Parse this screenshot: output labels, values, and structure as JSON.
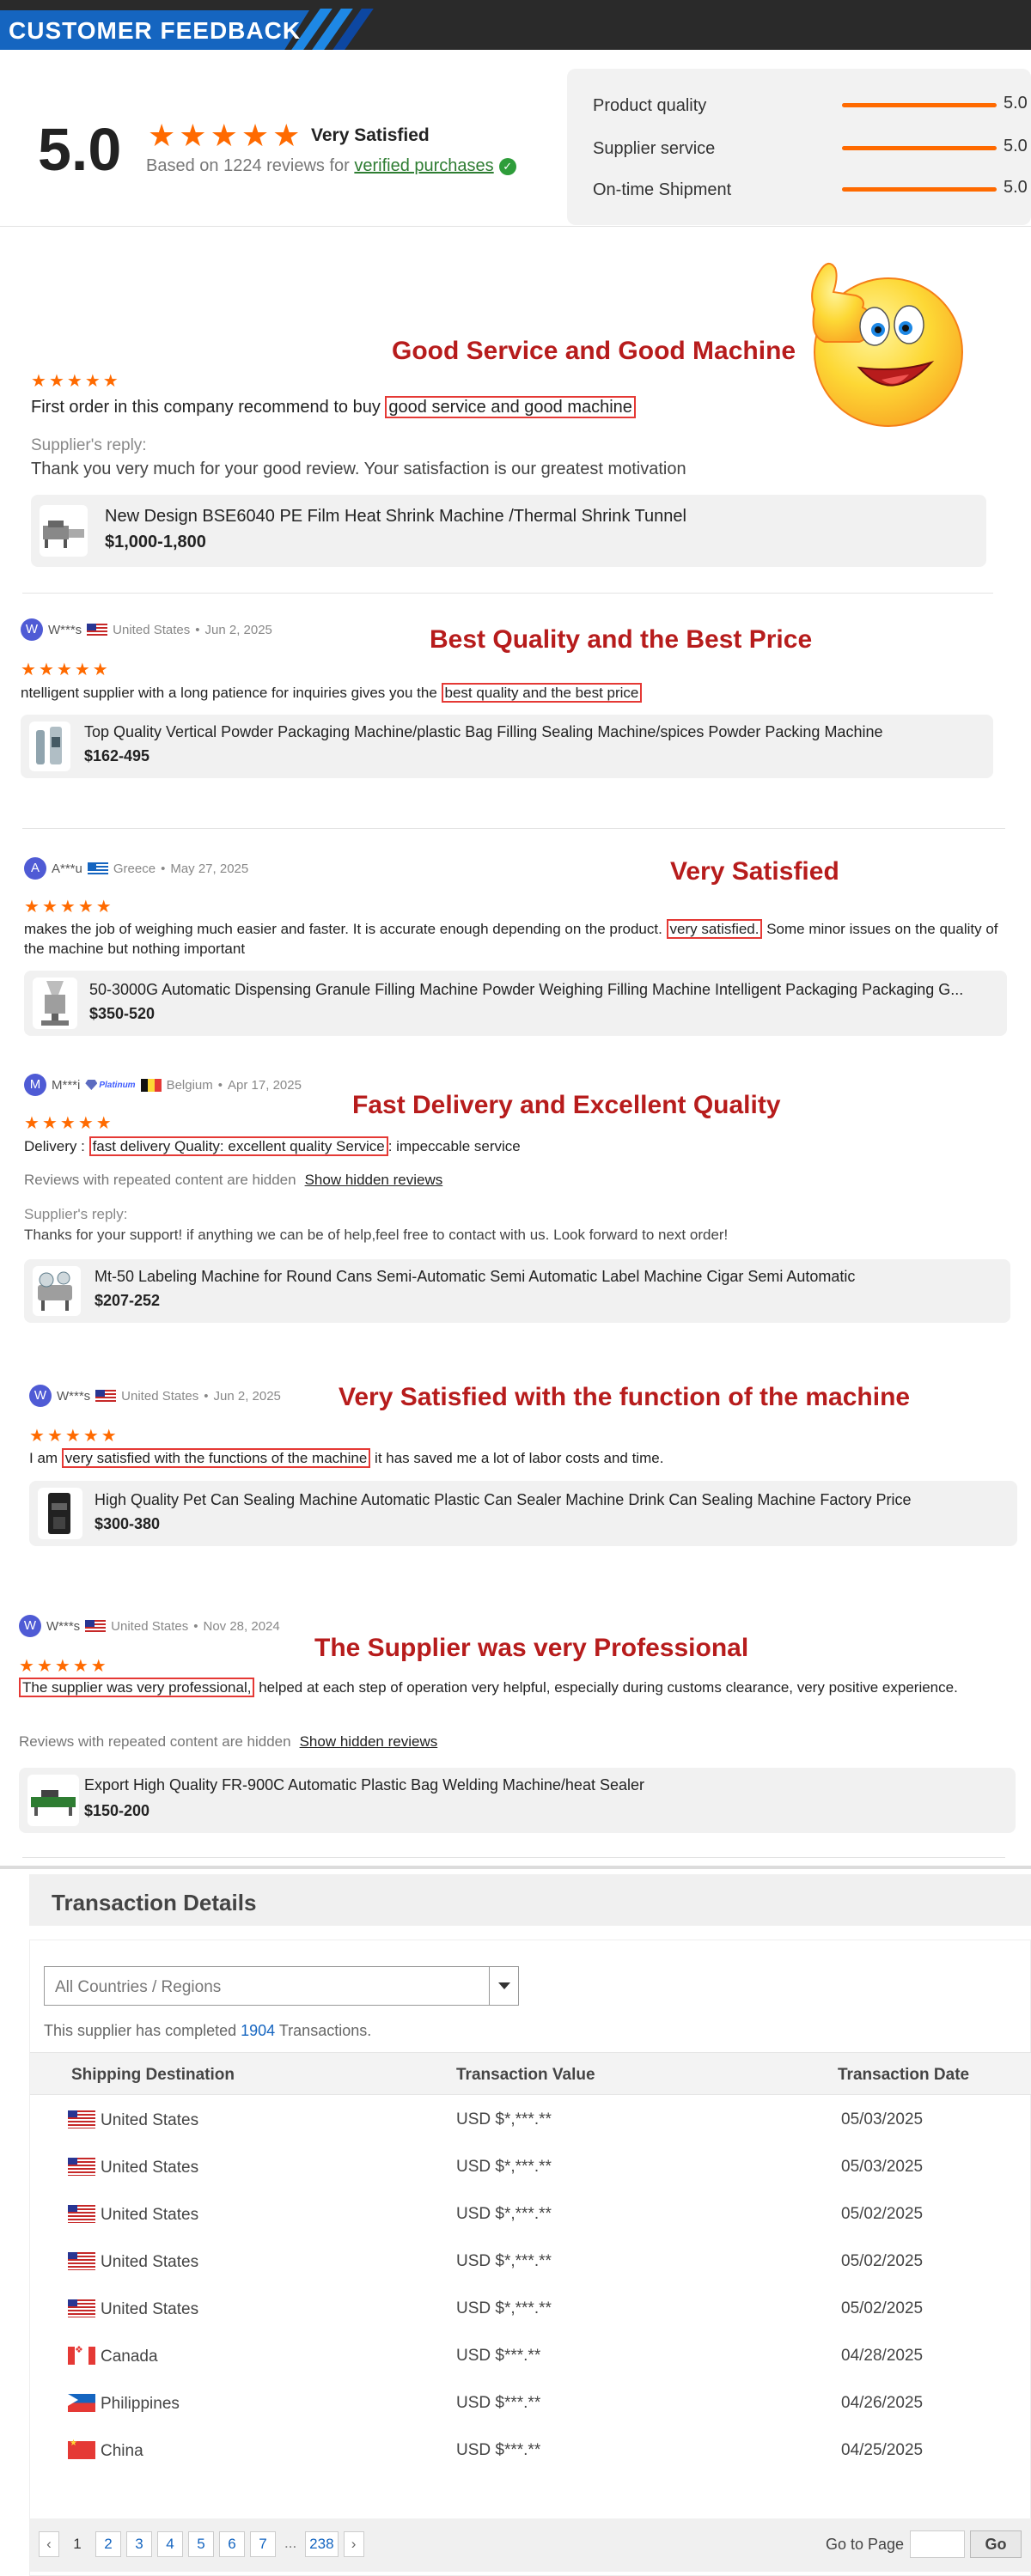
{
  "banner": {
    "title": "CUSTOMER  FEEDBACK"
  },
  "summary": {
    "score": "5.0",
    "stars": 5,
    "verdict": "Very Satisfied",
    "based_prefix": "Based on 1224 reviews for ",
    "verified_link": "verified purchases",
    "metrics": [
      {
        "label": "Product quality",
        "value": "5.0",
        "fraction": 1.0
      },
      {
        "label": "Supplier service",
        "value": "5.0",
        "fraction": 1.0
      },
      {
        "label": "On-time Shipment",
        "value": "5.0",
        "fraction": 1.0
      }
    ]
  },
  "reviews": [
    {
      "highlight_title": "Good Service and Good Machine",
      "stars": 5,
      "text_before": "First order in this company recommend to buy ",
      "text_highlight": "good service and good machine",
      "text_after": "",
      "reply_label": "Supplier's reply:",
      "reply_text": "Thank you very much for your good review. Your satisfaction is our greatest motivation",
      "product_name": "New Design BSE6040 PE Film Heat Shrink Machine /Thermal Shrink Tunnel",
      "product_price": "$1,000-1,800"
    },
    {
      "avatar": "W",
      "reviewer": "W***s",
      "country": "United States",
      "date": "Jun 2, 2025",
      "highlight_title": "Best Quality and the Best Price",
      "stars": 5,
      "text_before": "ntelligent supplier with a long patience for inquiries gives you the ",
      "text_highlight": "best quality and the best price",
      "text_after": "",
      "product_name": "Top Quality Vertical Powder Packaging Machine/plastic Bag Filling Sealing Machine/spices Powder Packing Machine",
      "product_price": "$162-495"
    },
    {
      "avatar": "A",
      "reviewer": "A***u",
      "country": "Greece",
      "date": "May 27, 2025",
      "highlight_title": "Very Satisfied",
      "stars": 5,
      "text_before": "makes the job of weighing much easier and faster. It is accurate enough depending on the product. ",
      "text_highlight": "very satisfied.",
      "text_after": " Some minor issues on the quality of the machine but nothing important",
      "product_name": "50-3000G Automatic Dispensing Granule Filling Machine Powder Weighing Filling Machine Intelligent Packaging Packaging G...",
      "product_price": "$350-520"
    },
    {
      "avatar": "M",
      "reviewer": "M***i",
      "badge": "Platinum",
      "country": "Belgium",
      "date": "Apr 17, 2025",
      "highlight_title": "Fast Delivery and Excellent Quality",
      "stars": 5,
      "text_before": "Delivery : ",
      "text_highlight": "fast delivery Quality: excellent quality Service",
      "text_after": ": impeccable service",
      "hidden_note": "Reviews with repeated content are hidden",
      "hidden_link": "Show hidden reviews",
      "reply_label": "Supplier's reply:",
      "reply_text": "Thanks for your support! if anything we can be of help,feel free to contact with us. Look forward to next order!",
      "product_name": "Mt-50 Labeling Machine for Round Cans Semi-Automatic Semi Automatic Label Machine Cigar Semi Automatic",
      "product_price": "$207-252"
    },
    {
      "avatar": "W",
      "reviewer": "W***s",
      "country": "United States",
      "date": "Jun 2, 2025",
      "highlight_title": "Very Satisfied with the function of the machine",
      "stars": 5,
      "text_before": "I am ",
      "text_highlight": "very satisfied with the functions of the machine",
      "text_after": " it has saved me a lot of labor costs and time.",
      "product_name": "High Quality Pet Can Sealing Machine Automatic Plastic Can Sealer Machine Drink Can Sealing Machine Factory Price",
      "product_price": "$300-380"
    },
    {
      "avatar": "W",
      "reviewer": "W***s",
      "country": "United States",
      "date": "Nov 28, 2024",
      "highlight_title": "The Supplier was very Professional",
      "stars": 5,
      "text_before": "",
      "text_highlight": "The supplier was very professional,",
      "text_after": " helped at each step of operation very helpful, especially during customs clearance, very positive experience.",
      "hidden_note": "Reviews with repeated content are hidden",
      "hidden_link": "Show hidden reviews",
      "product_name": "Export High Quality FR-900C Automatic Plastic Bag Welding Machine/heat Sealer",
      "product_price": "$150-200"
    }
  ],
  "transactions": {
    "title": "Transaction Details",
    "select_value": "All Countries / Regions",
    "completed_prefix": "This supplier has completed ",
    "completed_count": "1904",
    "completed_suffix": " Transactions.",
    "columns": [
      "Shipping Destination",
      "Transaction Value",
      "Transaction Date"
    ],
    "rows": [
      {
        "flag": "us",
        "destination": "United States",
        "value": "USD $*,***.**",
        "date": "05/03/2025"
      },
      {
        "flag": "us",
        "destination": "United States",
        "value": "USD $*,***.**",
        "date": "05/03/2025"
      },
      {
        "flag": "us",
        "destination": "United States",
        "value": "USD $*,***.**",
        "date": "05/02/2025"
      },
      {
        "flag": "us",
        "destination": "United States",
        "value": "USD $*,***.**",
        "date": "05/02/2025"
      },
      {
        "flag": "us",
        "destination": "United States",
        "value": "USD $*,***.**",
        "date": "05/02/2025"
      },
      {
        "flag": "ca",
        "destination": "Canada",
        "value": "USD $***.**",
        "date": "04/28/2025"
      },
      {
        "flag": "ph",
        "destination": "Philippines",
        "value": "USD $***.**",
        "date": "04/26/2025"
      },
      {
        "flag": "cn",
        "destination": "China",
        "value": "USD $***.**",
        "date": "04/25/2025"
      }
    ],
    "pages": [
      "1",
      "2",
      "3",
      "4",
      "5",
      "6",
      "7",
      "...",
      "238"
    ],
    "goto_label": "Go to Page",
    "goto_button": "Go"
  }
}
